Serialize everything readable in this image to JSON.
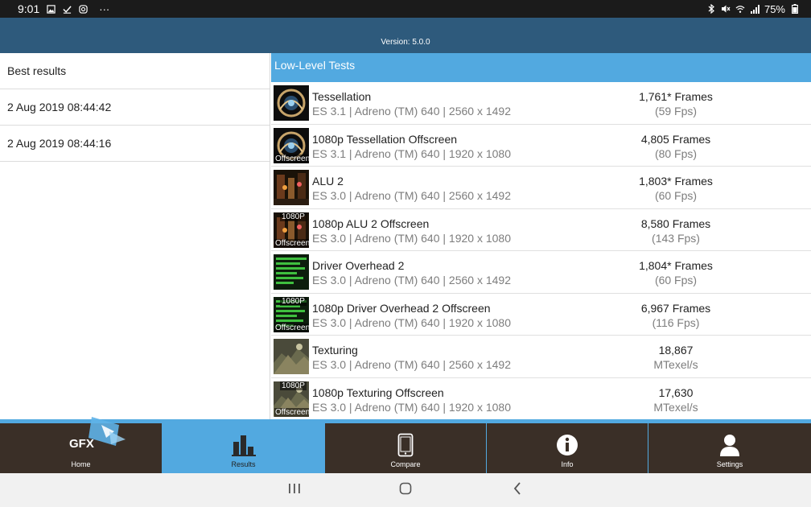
{
  "status_bar": {
    "time": "9:01",
    "more": "···",
    "battery": "75%",
    "left_icons": [
      "image-icon",
      "check-icon",
      "instagram-icon"
    ],
    "right_icons": [
      "bluetooth-icon",
      "mute-icon",
      "wifi-icon",
      "signal-icon"
    ]
  },
  "header": {
    "version": "Version: 5.0.0"
  },
  "left_panel": {
    "title": "Best results",
    "results": [
      "2 Aug 2019 08:44:42",
      "2 Aug 2019 08:44:16"
    ]
  },
  "section": {
    "title": "Low-Level Tests"
  },
  "tests": [
    {
      "name": "Tessellation",
      "sub": "ES 3.1 | Adreno (TM) 640 | 2560 x 1492",
      "score": "1,761* Frames",
      "unit": "(59 Fps)",
      "thumb": "tessellation",
      "badge_top": "",
      "badge_bottom": ""
    },
    {
      "name": "1080p Tessellation Offscreen",
      "sub": "ES 3.1 | Adreno (TM) 640 | 1920 x 1080",
      "score": "4,805 Frames",
      "unit": "(80 Fps)",
      "thumb": "tessellation",
      "badge_top": "",
      "badge_bottom": "Offscreen"
    },
    {
      "name": "ALU 2",
      "sub": "ES 3.0 | Adreno (TM) 640 | 2560 x 1492",
      "score": "1,803* Frames",
      "unit": "(60 Fps)",
      "thumb": "alu",
      "badge_top": "",
      "badge_bottom": ""
    },
    {
      "name": "1080p ALU 2 Offscreen",
      "sub": "ES 3.0 | Adreno (TM) 640 | 1920 x 1080",
      "score": "8,580 Frames",
      "unit": "(143 Fps)",
      "thumb": "alu",
      "badge_top": "1080P",
      "badge_bottom": "Offscreen"
    },
    {
      "name": "Driver Overhead 2",
      "sub": "ES 3.0 | Adreno (TM) 640 | 2560 x 1492",
      "score": "1,804* Frames",
      "unit": "(60 Fps)",
      "thumb": "driver",
      "badge_top": "",
      "badge_bottom": ""
    },
    {
      "name": "1080p Driver Overhead 2 Offscreen",
      "sub": "ES 3.0 | Adreno (TM) 640 | 1920 x 1080",
      "score": "6,967 Frames",
      "unit": "(116 Fps)",
      "thumb": "driver",
      "badge_top": "1080P",
      "badge_bottom": "Offscreen"
    },
    {
      "name": "Texturing",
      "sub": "ES 3.0 | Adreno (TM) 640 | 2560 x 1492",
      "score": "18,867",
      "unit": "MTexel/s",
      "thumb": "texturing",
      "badge_top": "",
      "badge_bottom": ""
    },
    {
      "name": "1080p Texturing Offscreen",
      "sub": "ES 3.0 | Adreno (TM) 640 | 1920 x 1080",
      "score": "17,630",
      "unit": "MTexel/s",
      "thumb": "texturing",
      "badge_top": "1080P",
      "badge_bottom": "Offscreen"
    }
  ],
  "tabs": [
    {
      "label": "Home",
      "icon": "gfx-logo-icon",
      "active": false
    },
    {
      "label": "Results",
      "icon": "bar-chart-icon",
      "active": true
    },
    {
      "label": "Compare",
      "icon": "phone-icon",
      "active": false
    },
    {
      "label": "Info",
      "icon": "info-icon",
      "active": false
    },
    {
      "label": "Settings",
      "icon": "user-icon",
      "active": false
    }
  ],
  "home_logo_text": "GFX",
  "nav_buttons": [
    "recents-icon",
    "home-icon",
    "back-icon"
  ],
  "colors": {
    "header": "#2e5a7c",
    "accent": "#52a9e0",
    "tab_bg": "#3a2f27",
    "status_bar": "#1b1b1b"
  }
}
